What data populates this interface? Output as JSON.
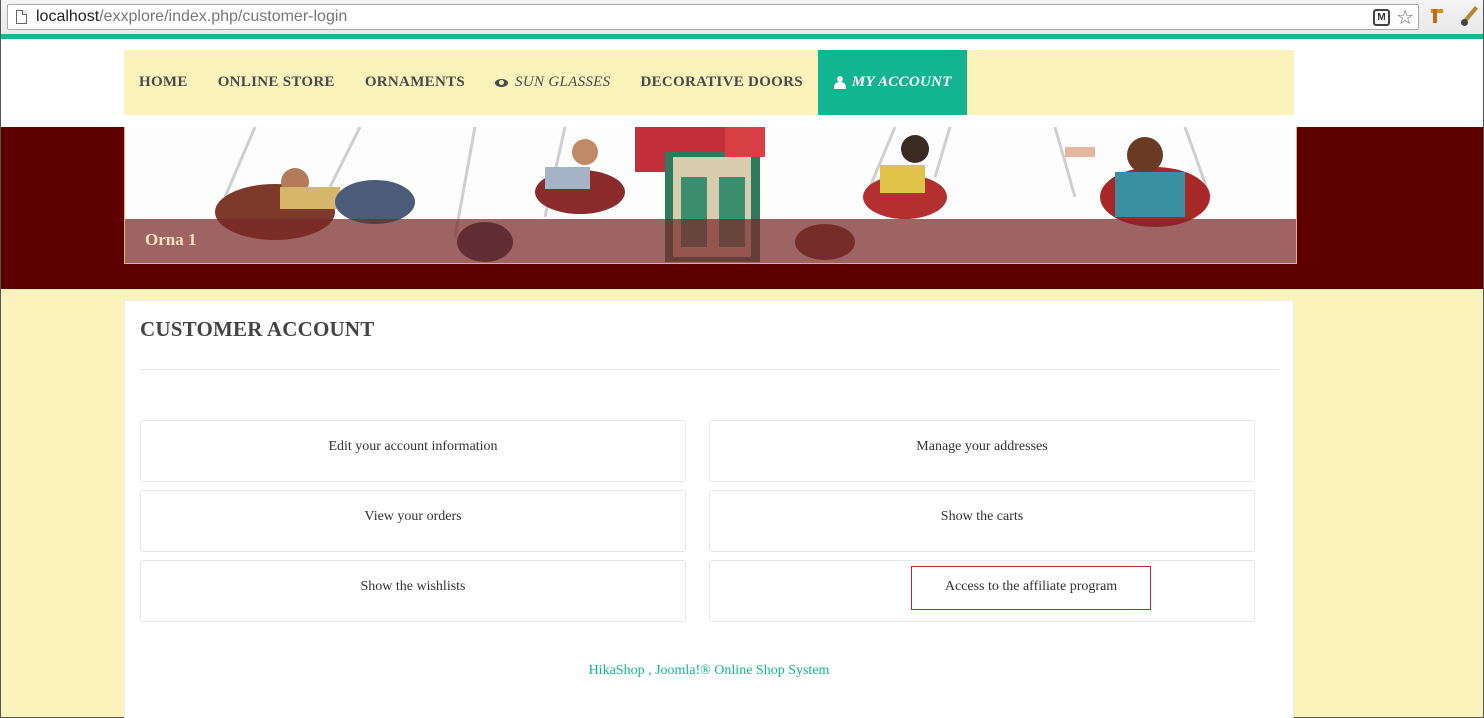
{
  "browser": {
    "url_host": "localhost",
    "url_path": "/exxplore/index.php/customer-login"
  },
  "nav": {
    "items": [
      {
        "label": "HOME"
      },
      {
        "label": "ONLINE STORE"
      },
      {
        "label": "ORNAMENTS"
      },
      {
        "label": "SUN GLASSES"
      },
      {
        "label": "DECORATIVE DOORS"
      },
      {
        "label": "MY ACCOUNT"
      }
    ]
  },
  "banner": {
    "caption": "Orna 1"
  },
  "account": {
    "title": "CUSTOMER ACCOUNT",
    "tiles": [
      {
        "label": "Edit your account information"
      },
      {
        "label": "Manage your addresses"
      },
      {
        "label": "View your orders"
      },
      {
        "label": "Show the carts"
      },
      {
        "label": "Show the wishlists"
      },
      {
        "label": "Access to the affiliate program"
      }
    ],
    "footer": "HikaShop , Joomla!® Online Shop System"
  },
  "colors": {
    "accent": "#13b590",
    "navbar_bg": "#faf3bb",
    "banner_bg": "#5f0000",
    "highlight_border": "#c0262e"
  }
}
